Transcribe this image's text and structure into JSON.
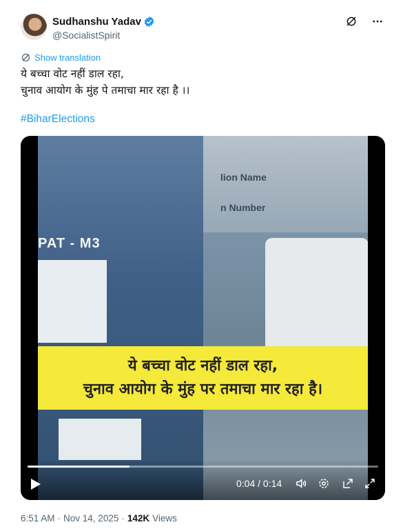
{
  "author": {
    "display_name": "Sudhanshu Yadav",
    "handle": "@SocialistSpirit"
  },
  "actions": {
    "translate_label": "Show translation"
  },
  "tweet": {
    "line1": "ये बच्चा वोट नहीं डाल रहा,",
    "line2": "चुनाव आयोग के मुंह पे तमाचा मार रहा है ।।",
    "hashtag": "#BiharElections"
  },
  "video": {
    "frame_label_vvpat": "PAT - M3",
    "frame_wall_line1": "lion Name",
    "frame_wall_line2": "n Number",
    "subtitle_line1": "ये बच्चा वोट नहीं डाल रहा,",
    "subtitle_line2": "चुनाव आयोग के मुंह पर तमाचा मार रहा है।",
    "time_display": "0:04 / 0:14",
    "progress_fraction": 0.29
  },
  "meta": {
    "time": "6:51 AM",
    "separator": "·",
    "date": "Nov 14, 2025",
    "views_count": "142K",
    "views_label": "Views"
  },
  "colors": {
    "accent": "#1d9bf0",
    "subtitle_bg": "#f5e93a"
  }
}
